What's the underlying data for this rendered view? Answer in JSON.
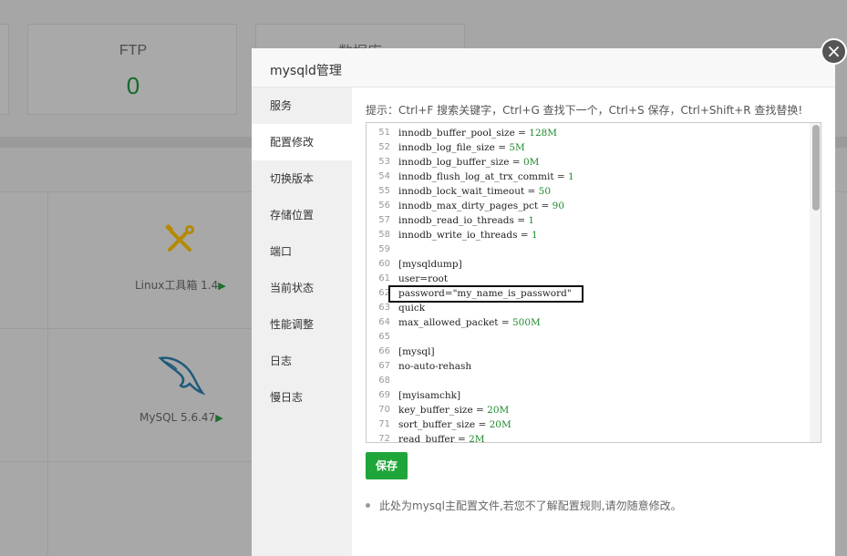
{
  "background": {
    "ftp_card": {
      "title": "FTP",
      "value": "0"
    },
    "db_card": {
      "title": "数据库"
    },
    "tools": [
      {
        "icon": "wrench-screwdriver-icon",
        "label": "Linux工具箱 1.4",
        "arrow": "▶"
      },
      {
        "icon": "mysql-dolphin-icon",
        "label": "MySQL 5.6.47",
        "arrow": "▶"
      }
    ],
    "accent_color": "#20a53a"
  },
  "modal": {
    "title": "mysqld管理",
    "close_label": "×",
    "sidebar": {
      "items": [
        {
          "label": "服务",
          "active": false
        },
        {
          "label": "配置修改",
          "active": true
        },
        {
          "label": "切换版本",
          "active": false
        },
        {
          "label": "存储位置",
          "active": false
        },
        {
          "label": "端口",
          "active": false
        },
        {
          "label": "当前状态",
          "active": false
        },
        {
          "label": "性能调整",
          "active": false
        },
        {
          "label": "日志",
          "active": false
        },
        {
          "label": "慢日志",
          "active": false
        }
      ]
    },
    "hint": "提示：Ctrl+F 搜索关键字，Ctrl+G 查找下一个，Ctrl+S 保存，Ctrl+Shift+R 查找替换!",
    "editor": {
      "lines": [
        {
          "n": "51",
          "text": "innodb_buffer_pool_size = ",
          "num": "128M"
        },
        {
          "n": "52",
          "text": "innodb_log_file_size = ",
          "num": "5M"
        },
        {
          "n": "53",
          "text": "innodb_log_buffer_size = ",
          "num": "0M"
        },
        {
          "n": "54",
          "text": "innodb_flush_log_at_trx_commit = ",
          "num": "1"
        },
        {
          "n": "55",
          "text": "innodb_lock_wait_timeout = ",
          "num": "50"
        },
        {
          "n": "56",
          "text": "innodb_max_dirty_pages_pct = ",
          "num": "90"
        },
        {
          "n": "57",
          "text": "innodb_read_io_threads = ",
          "num": "1"
        },
        {
          "n": "58",
          "text": "innodb_write_io_threads = ",
          "num": "1"
        },
        {
          "n": "59",
          "text": "",
          "num": ""
        },
        {
          "n": "60",
          "text": "[mysqldump]",
          "num": ""
        },
        {
          "n": "61",
          "text": "user=root",
          "num": ""
        },
        {
          "n": "62",
          "text": "password=\"my_name_is_password\"",
          "num": ""
        },
        {
          "n": "63",
          "text": "quick",
          "num": ""
        },
        {
          "n": "64",
          "text": "max_allowed_packet = ",
          "num": "500M"
        },
        {
          "n": "65",
          "text": "",
          "num": ""
        },
        {
          "n": "66",
          "text": "[mysql]",
          "num": ""
        },
        {
          "n": "67",
          "text": "no-auto-rehash",
          "num": ""
        },
        {
          "n": "68",
          "text": "",
          "num": ""
        },
        {
          "n": "69",
          "text": "[myisamchk]",
          "num": ""
        },
        {
          "n": "70",
          "text": "key_buffer_size = ",
          "num": "20M"
        },
        {
          "n": "71",
          "text": "sort_buffer_size = ",
          "num": "20M"
        },
        {
          "n": "72",
          "text": "read_buffer = ",
          "num": "2M"
        }
      ]
    },
    "save_label": "保存",
    "note": "此处为mysql主配置文件,若您不了解配置规则,请勿随意修改。"
  }
}
